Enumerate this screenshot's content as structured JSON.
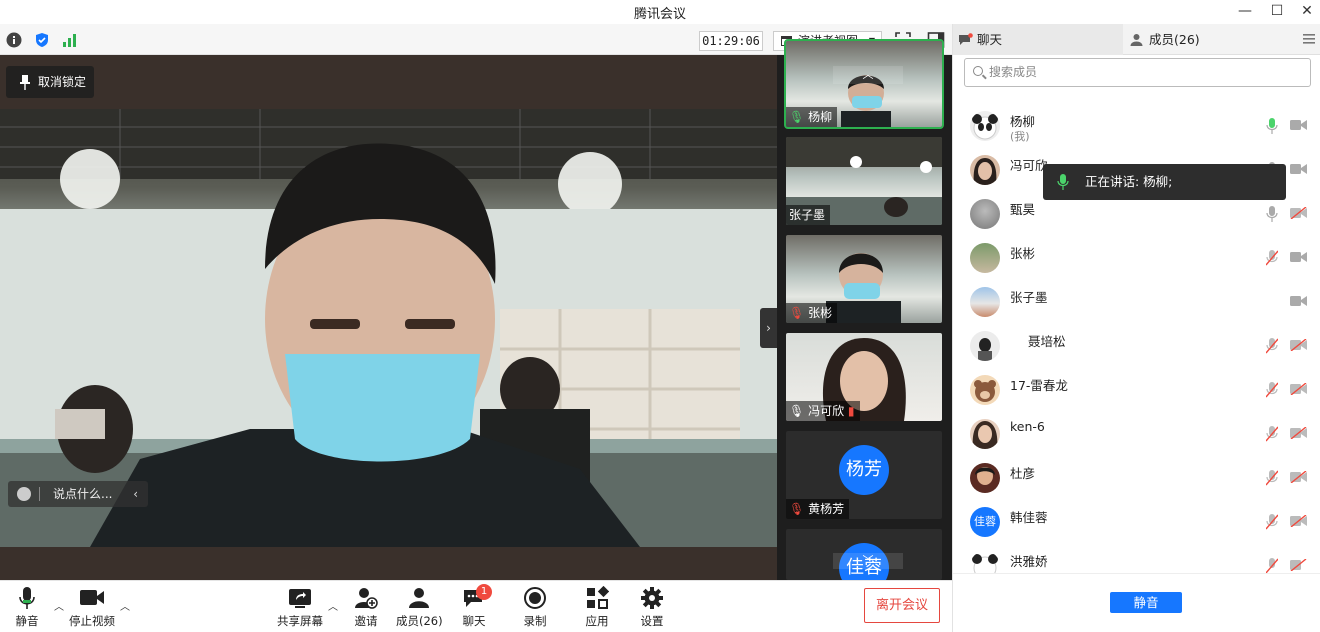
{
  "window": {
    "title": "腾讯会议"
  },
  "topbar": {
    "timer": "01:29:06",
    "view_mode": "演讲者视图"
  },
  "stage": {
    "unpin_label": "取消锁定",
    "chat_placeholder": "说点什么..."
  },
  "thumbnails": [
    {
      "name": "杨柳",
      "type": "video",
      "active": true
    },
    {
      "name": "张子墨",
      "type": "video"
    },
    {
      "name": "张彬",
      "type": "video"
    },
    {
      "name": "冯可欣",
      "type": "video"
    },
    {
      "name": "黄杨芳",
      "type": "avatar",
      "avatar_text": "杨芳"
    },
    {
      "name": "",
      "type": "avatar",
      "avatar_text": "佳蓉"
    }
  ],
  "toolbar": {
    "mute": "静音",
    "stop_video": "停止视频",
    "share": "共享屏幕",
    "invite": "邀请",
    "members": "成员(26)",
    "chat": "聊天",
    "chat_badge": "1",
    "record": "录制",
    "apps": "应用",
    "settings": "设置",
    "leave": "离开会议"
  },
  "panel": {
    "tab_chat": "聊天",
    "tab_members": "成员(26)",
    "search_placeholder": "搜索成员",
    "speaking": "正在讲话: 杨柳;",
    "mute_all": "静音",
    "members": [
      {
        "name": "杨柳",
        "sub": "(我)",
        "mic": "on-green",
        "cam": "on"
      },
      {
        "name": "冯可欣",
        "sub": "",
        "mic": "on",
        "cam": "on"
      },
      {
        "name": "甄昊",
        "sub": "",
        "mic": "on",
        "cam": "off"
      },
      {
        "name": "张彬",
        "sub": "",
        "mic": "off",
        "cam": "on"
      },
      {
        "name": "张子墨",
        "sub": "",
        "mic": "none",
        "cam": "on"
      },
      {
        "name": "聂培松",
        "sub": "",
        "mic": "off",
        "cam": "off"
      },
      {
        "name": "17-雷春龙",
        "sub": "",
        "mic": "off",
        "cam": "off"
      },
      {
        "name": "ken-6",
        "sub": "",
        "mic": "off",
        "cam": "off"
      },
      {
        "name": "杜彦",
        "sub": "",
        "mic": "off",
        "cam": "off"
      },
      {
        "name": "韩佳蓉",
        "sub": "",
        "mic": "off",
        "cam": "off",
        "avatar_text": "佳蓉"
      },
      {
        "name": "洪雅娇",
        "sub": "",
        "mic": "off",
        "cam": "off"
      }
    ]
  }
}
